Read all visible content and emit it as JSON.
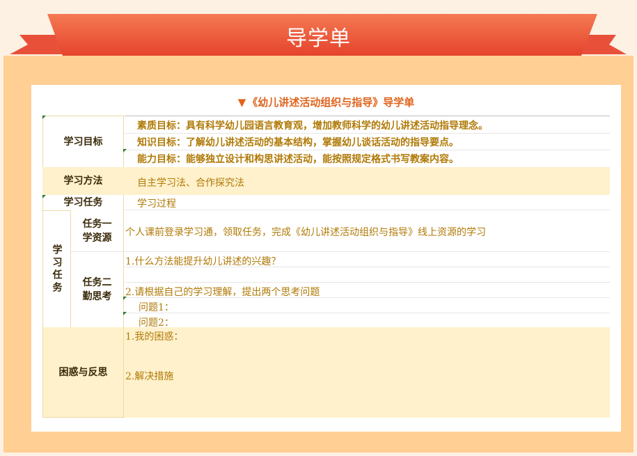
{
  "header": {
    "title": "导学单"
  },
  "doc": {
    "title": "《幼儿讲述活动组织与指导》导学单",
    "marker_icon": "triangle-down-icon"
  },
  "rows": {
    "goals": {
      "label": "学习目标",
      "items": [
        "素质目标：具有科学幼儿园语言教育观，增加教师科学的幼儿讲述活动指导理念。",
        "知识目标：了解幼儿讲述活动的基本结构，掌握幼儿谈话活动的指导要点。",
        "能力目标：能够独立设计和构思讲述活动，能按照规定格式书写教案内容。"
      ]
    },
    "method": {
      "label": "学习方法",
      "value": "自主学习法、合作探究法"
    },
    "task_header": {
      "label": "学习任务",
      "value": "学习过程"
    },
    "tasks": {
      "label": "学习任务",
      "task1": {
        "label": "任务一学资源",
        "content": "个人课前登录学习通，领取任务，完成《幼儿讲述活动组织与指导》线上资源的学习"
      },
      "task2": {
        "label": "任务二勤思考",
        "q1": "1.什么方法能提升幼儿讲述的兴趣？",
        "q2": "2.请根据自己的学习理解，提出两个思考问题",
        "p1": "问题1：",
        "p2": "问题2："
      }
    },
    "reflection": {
      "label": "困惑与反思",
      "item1": "1.我的困惑：",
      "item2": "2.解决措施"
    }
  },
  "colors": {
    "accent": "#e0641d",
    "ribbon": "#ec5a3a",
    "band": "#ffcf94",
    "row_highlight": "#fff1cc",
    "text_gold": "#b07a07"
  }
}
